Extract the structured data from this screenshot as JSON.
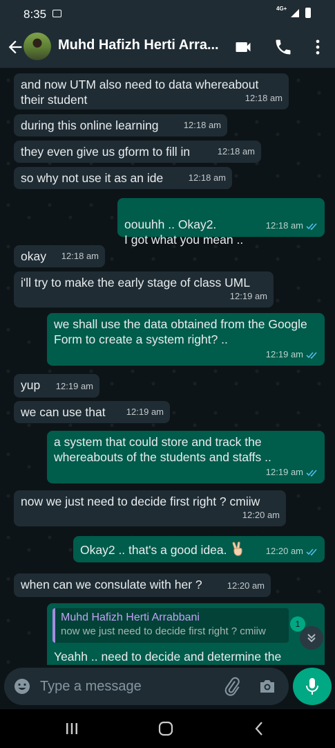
{
  "status_bar": {
    "time": "8:35",
    "network": "4G+"
  },
  "header": {
    "contact_name": "Muhd Hafizh Herti Arra..."
  },
  "messages": [
    {
      "dir": "in",
      "text": "and now UTM also need to data whereabout their student",
      "time": "12:18 am"
    },
    {
      "dir": "in",
      "text": "during this online learning",
      "time": "12:18 am"
    },
    {
      "dir": "in",
      "text": "they even give us gform to fill in",
      "time": "12:18 am"
    },
    {
      "dir": "in",
      "text": "so why not use it as an ide",
      "time": "12:18 am"
    },
    {
      "dir": "out",
      "text": "oouuhh .. Okay2.\nI got what you mean ..",
      "time": "12:18 am"
    },
    {
      "dir": "in",
      "text": "okay",
      "time": "12:18 am"
    },
    {
      "dir": "in",
      "text": "i'll try to make the early stage of class UML",
      "time": "12:19 am"
    },
    {
      "dir": "out",
      "text": "we shall use the data obtained from the Google Form to create a system right? ..",
      "time": "12:19 am"
    },
    {
      "dir": "in",
      "text": "yup",
      "time": "12:19 am"
    },
    {
      "dir": "in",
      "text": "we can use that",
      "time": "12:19 am"
    },
    {
      "dir": "out",
      "text": "a system that could store and track the whereabouts of the students and staffs ..",
      "time": "12:19 am"
    },
    {
      "dir": "in",
      "text": "now we just need to decide first right ? cmiiw",
      "time": "12:20 am"
    },
    {
      "dir": "out",
      "text": "Okay2 .. that's a good idea.",
      "time": "12:20 am",
      "emoji": "victory-hand"
    },
    {
      "dir": "in",
      "text": "when can we consulate with her ?",
      "time": "12:20 am"
    }
  ],
  "reply_message": {
    "quoted_name": "Muhd Hafizh Herti Arrabbani",
    "quoted_text": "now we just need to decide first right ? cmiiw",
    "text": "Yeahh .. need to decide and determine the"
  },
  "unread_badge": "1",
  "composer": {
    "placeholder": "Type a message"
  },
  "colors": {
    "incoming": "#1f2c34",
    "outgoing": "#005c4b",
    "accent": "#00a884",
    "read_tick": "#53bdeb"
  }
}
